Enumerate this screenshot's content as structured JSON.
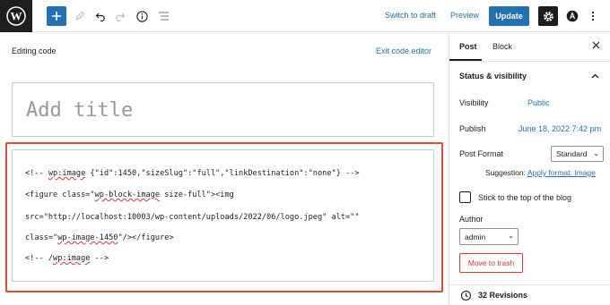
{
  "toolbar": {
    "switch_to_draft": "Switch to draft",
    "preview": "Preview",
    "update": "Update"
  },
  "editor": {
    "editing_label": "Editing code",
    "exit_code_editor": "Exit code editor",
    "title_placeholder": "Add title",
    "code_lines": [
      [
        "<!-- ",
        "wp:image",
        " {\"id\":1450,\"sizeSlug\":\"full\",\"linkDestination\":\"none\"} -->"
      ],
      [
        "<figure class=\"",
        "wp-block-image",
        " size-full\"><img"
      ],
      [
        "src=\"http://localhost:10003/wp-content/uploads/2022/06/logo.jpeg\" alt=\"\""
      ],
      [
        "class=\"",
        "wp-image-1450",
        "\"/></figure>"
      ],
      [
        "<!-- /",
        "wp:image",
        " -->"
      ]
    ]
  },
  "sidebar": {
    "tab_post": "Post",
    "tab_block": "Block",
    "panel_title": "Status & visibility",
    "visibility_label": "Visibility",
    "visibility_value": "Public",
    "publish_label": "Publish",
    "publish_value": "June 18, 2022 7:42 pm",
    "post_format_label": "Post Format",
    "post_format_value": "Standard",
    "suggestion_label": "Suggestion:",
    "suggestion_link": "Apply format: Image",
    "sticky_label": "Stick to the top of the blog",
    "author_label": "Author",
    "author_value": "admin",
    "move_to_trash": "Move to trash",
    "revisions": "32 Revisions"
  },
  "colors": {
    "accent": "#2271b1",
    "highlight_border": "#e04a33",
    "danger": "#d63638"
  }
}
